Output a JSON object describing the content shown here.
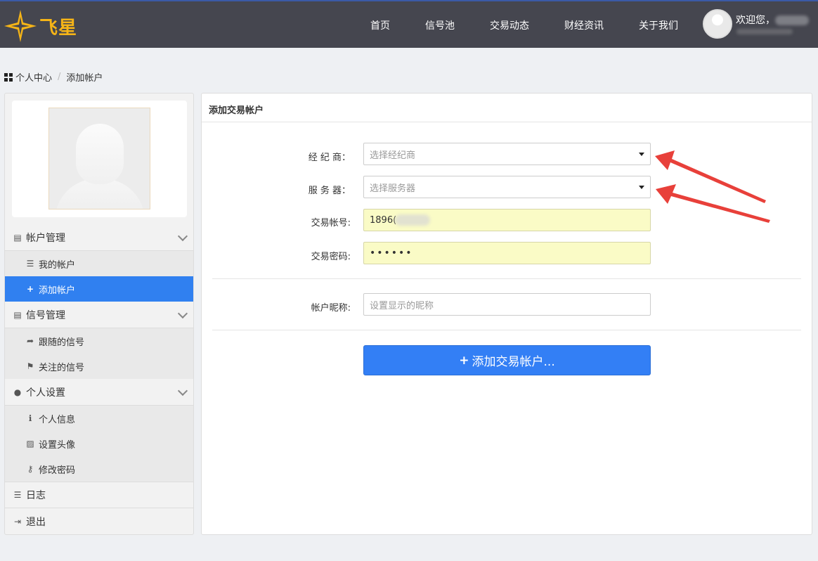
{
  "brand": {
    "name": "飞星"
  },
  "nav": {
    "items": [
      "首页",
      "信号池",
      "交易动态",
      "财经资讯",
      "关于我们"
    ]
  },
  "user": {
    "welcome": "欢迎您，"
  },
  "breadcrumb": {
    "home": "个人中心",
    "current": "添加帐户"
  },
  "sidebar": {
    "groups": [
      {
        "label": "帐户管理",
        "icon": "id-card-icon"
      },
      {
        "label": "信号管理",
        "icon": "id-card-icon"
      },
      {
        "label": "个人设置",
        "icon": "user-icon"
      },
      {
        "label": "日志",
        "icon": "list-icon"
      },
      {
        "label": "退出",
        "icon": "sign-out-icon"
      }
    ],
    "items": [
      {
        "label": "我的帐户",
        "icon": "list-icon"
      },
      {
        "label": "添加帐户",
        "icon": "plus-icon",
        "active": true
      },
      {
        "label": "跟随的信号",
        "icon": "share-icon"
      },
      {
        "label": "关注的信号",
        "icon": "flag-icon"
      },
      {
        "label": "个人信息",
        "icon": "info-icon"
      },
      {
        "label": "设置头像",
        "icon": "image-icon"
      },
      {
        "label": "修改密码",
        "icon": "key-icon"
      }
    ]
  },
  "form": {
    "title": "添加交易帐户",
    "broker": {
      "label": "经 纪 商：",
      "placeholder": "选择经纪商"
    },
    "server": {
      "label": "服 务 器：",
      "placeholder": "选择服务器"
    },
    "account": {
      "label": "交易帐号:",
      "value": "1896("
    },
    "password": {
      "label": "交易密码:",
      "value": "••••••"
    },
    "nickname": {
      "label": "帐户昵称:",
      "placeholder": "设置显示的昵称"
    },
    "submit": "添加交易帐户..."
  },
  "colors": {
    "topbar": "#45464f",
    "accent": "#337ff5",
    "brand": "#f5b417",
    "arrow": "#e8403a"
  }
}
